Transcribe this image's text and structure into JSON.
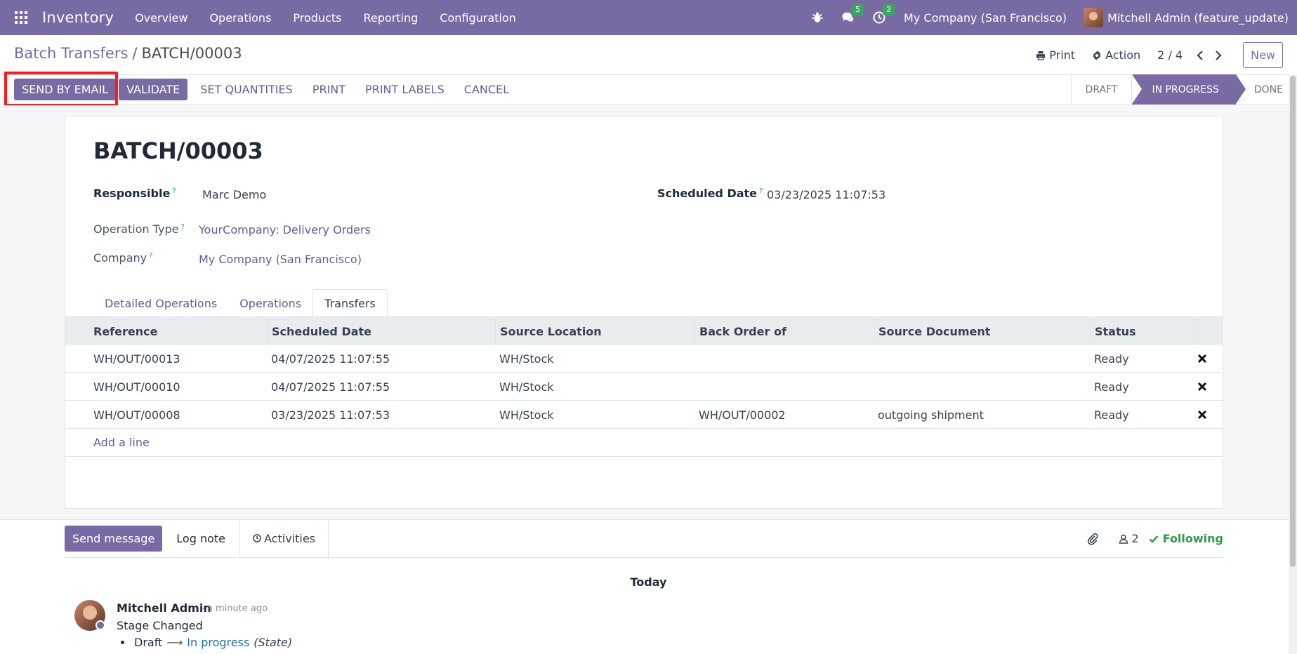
{
  "navbar": {
    "brand": "Inventory",
    "menu": [
      "Overview",
      "Operations",
      "Products",
      "Reporting",
      "Configuration"
    ],
    "messages_count": "5",
    "activities_count": "2",
    "company": "My Company (San Francisco)",
    "user": "Mitchell Admin (feature_update)"
  },
  "breadcrumb": {
    "parent": "Batch Transfers",
    "separator": "/",
    "current": "BATCH/00003"
  },
  "control": {
    "print_label": "Print",
    "action_label": "Action",
    "pager": "2 / 4",
    "new_label": "New"
  },
  "actions": {
    "send_by_email": "SEND BY EMAIL",
    "validate": "VALIDATE",
    "set_quantities": "SET QUANTITIES",
    "print": "PRINT",
    "print_labels": "PRINT LABELS",
    "cancel": "CANCEL"
  },
  "stages": {
    "draft": "DRAFT",
    "in_progress": "IN PROGRESS",
    "done": "DONE",
    "current": "IN PROGRESS"
  },
  "form": {
    "title": "BATCH/00003",
    "responsible_label": "Responsible",
    "responsible_value": "Marc Demo",
    "scheduled_label": "Scheduled Date",
    "scheduled_value": "03/23/2025 11:07:53",
    "operation_type_label": "Operation Type",
    "operation_type_value": "YourCompany: Delivery Orders",
    "company_label": "Company",
    "company_value": "My Company (San Francisco)",
    "help_mark": "?"
  },
  "tabs": {
    "detailed": "Detailed Operations",
    "operations": "Operations",
    "transfers": "Transfers",
    "active": "Transfers"
  },
  "table": {
    "headers": {
      "reference": "Reference",
      "scheduled_date": "Scheduled Date",
      "source_location": "Source Location",
      "back_order": "Back Order of",
      "source_document": "Source Document",
      "status": "Status"
    },
    "rows": [
      {
        "reference": "WH/OUT/00013",
        "scheduled_date": "04/07/2025 11:07:55",
        "source_location": "WH/Stock",
        "back_order": "",
        "source_document": "",
        "status": "Ready"
      },
      {
        "reference": "WH/OUT/00010",
        "scheduled_date": "04/07/2025 11:07:55",
        "source_location": "WH/Stock",
        "back_order": "",
        "source_document": "",
        "status": "Ready"
      },
      {
        "reference": "WH/OUT/00008",
        "scheduled_date": "03/23/2025 11:07:53",
        "source_location": "WH/Stock",
        "back_order": "WH/OUT/00002",
        "source_document": "outgoing shipment",
        "status": "Ready"
      }
    ],
    "add_line": "Add a line"
  },
  "chatter": {
    "send_message": "Send message",
    "log_note": "Log note",
    "activities": "Activities",
    "followers_count": "2",
    "following": "Following",
    "date_divider": "Today",
    "message": {
      "author": "Mitchell Admin",
      "time": "- a minute ago",
      "body": "Stage Changed",
      "old_value": "Draft",
      "new_value": "In progress",
      "field": "(State)"
    }
  },
  "colors": {
    "brand": "#7a6aa3",
    "success": "#2e9b49",
    "highlight": "#ff1a1a"
  }
}
